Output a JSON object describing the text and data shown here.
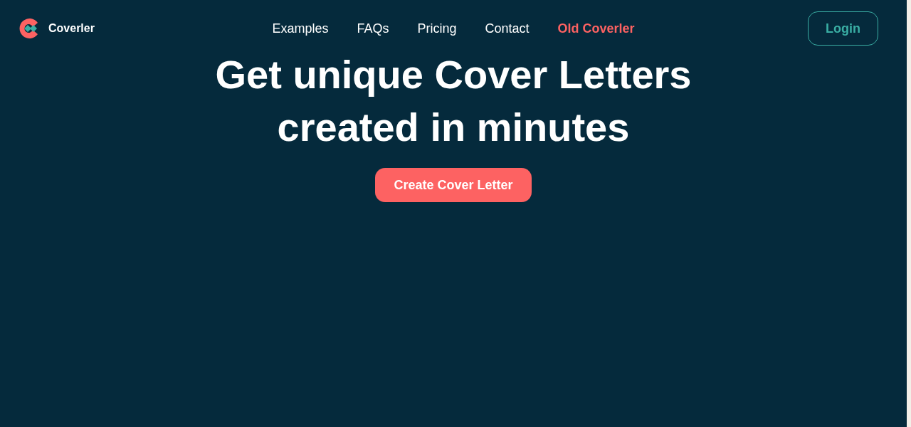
{
  "logo": {
    "text": "Coverler"
  },
  "nav": [
    {
      "label": "Examples",
      "highlighted": false
    },
    {
      "label": "FAQs",
      "highlighted": false
    },
    {
      "label": "Pricing",
      "highlighted": false
    },
    {
      "label": "Contact",
      "highlighted": false
    },
    {
      "label": "Old Coverler",
      "highlighted": true
    }
  ],
  "login_button": "Login",
  "hero": {
    "title_lines": [
      "Get unique Cover Letters",
      "created in minutes"
    ],
    "cta": "Create Cover Letter"
  }
}
